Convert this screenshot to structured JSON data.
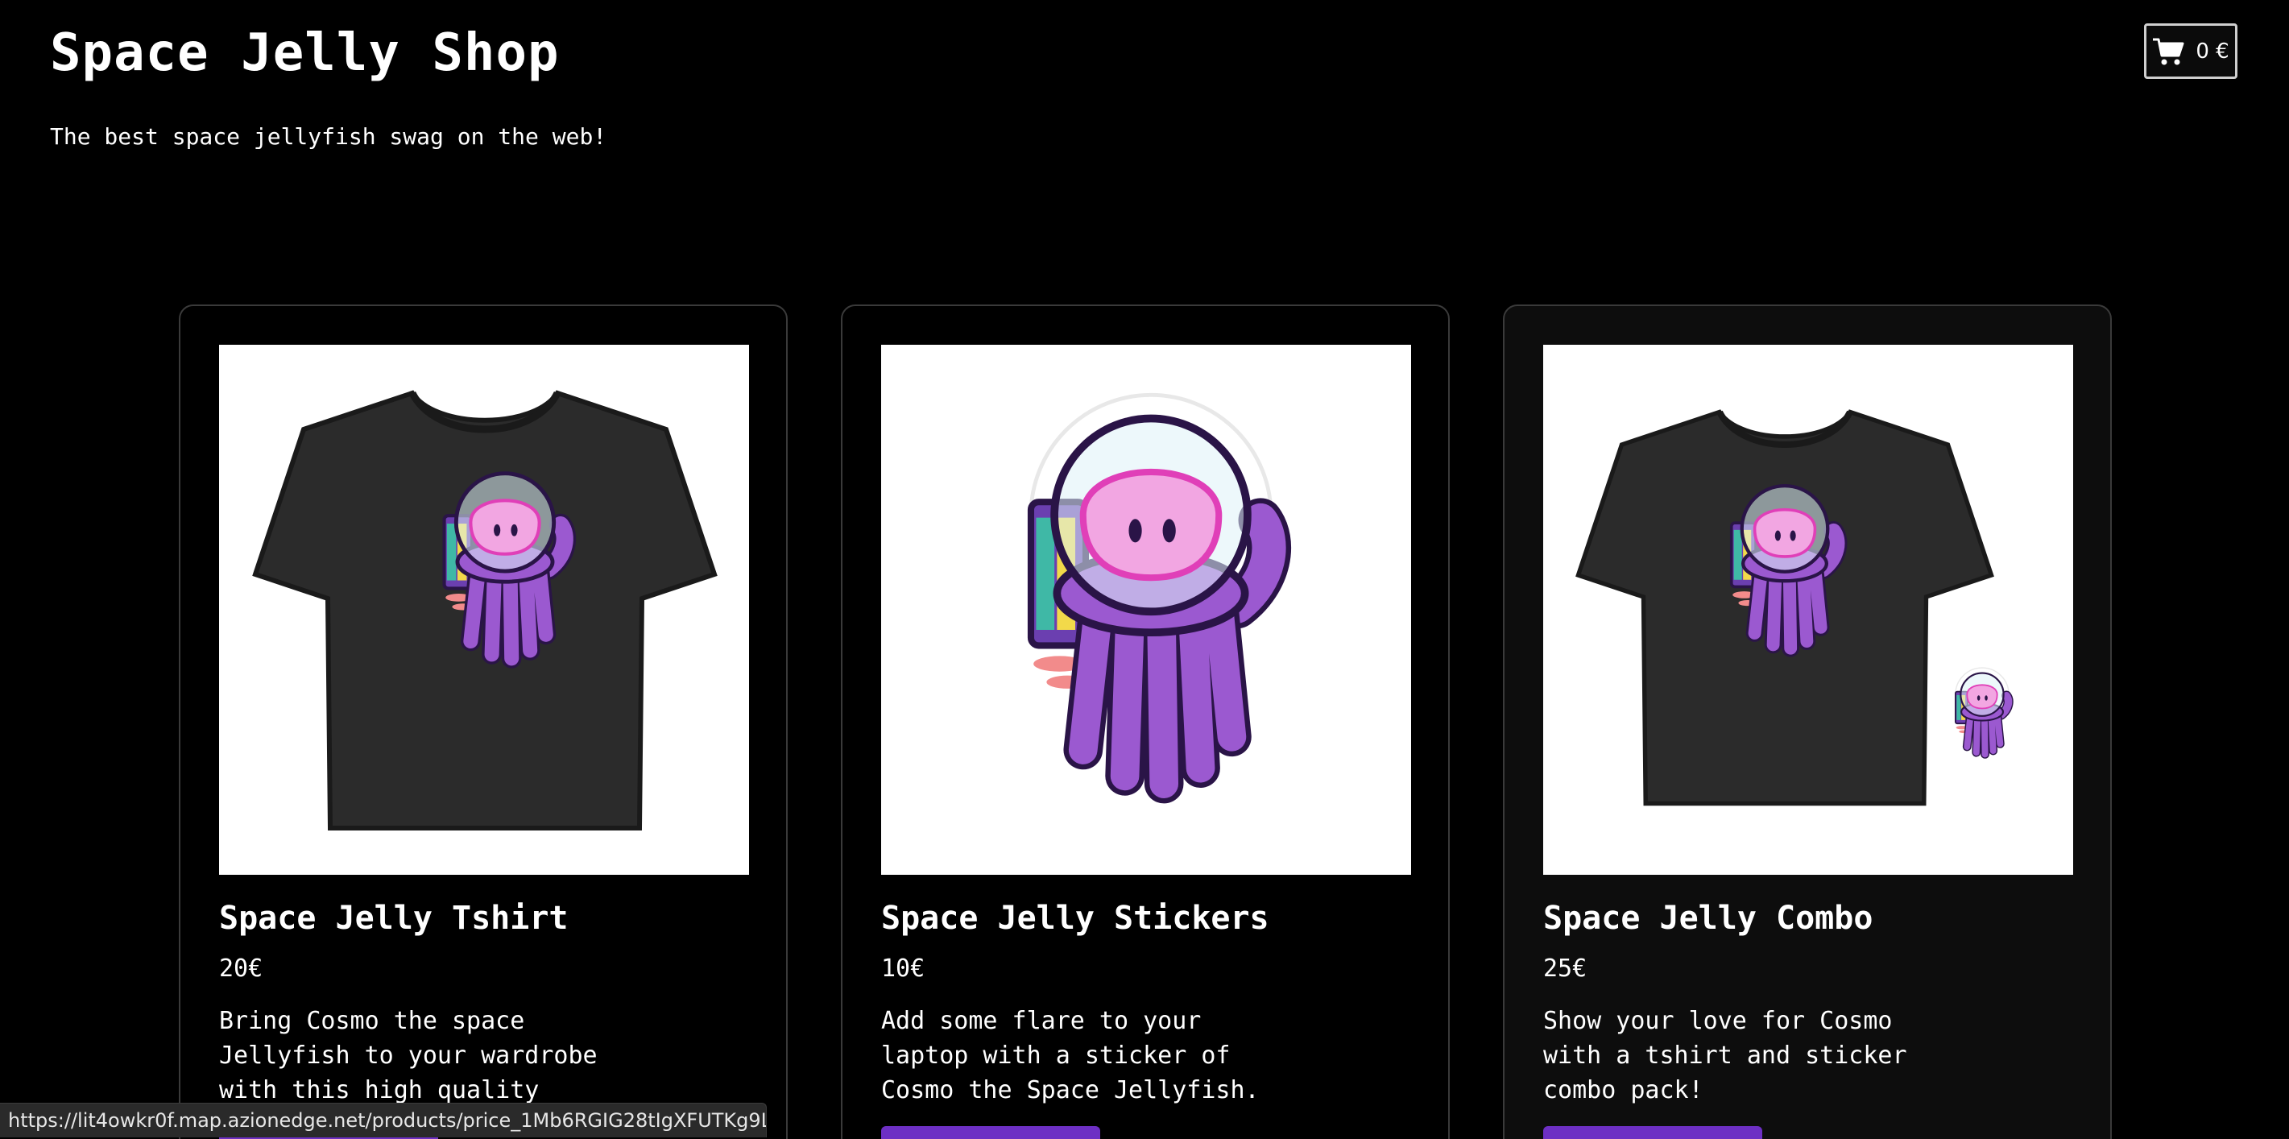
{
  "header": {
    "title": "Space Jelly Shop",
    "tagline": "The best space jellyfish swag on the web!"
  },
  "cart": {
    "icon": "shopping-cart-icon",
    "total": "0 €"
  },
  "products": [
    {
      "image_alt": "Space Jelly Tshirt",
      "title": "Space Jelly Tshirt",
      "price": "20€",
      "description": "Bring Cosmo the space Jellyfish to your wardrobe with this high quality tshirt."
    },
    {
      "image_alt": "Space Jelly Stickers",
      "title": "Space Jelly Stickers",
      "price": "10€",
      "description": "Add some flare to your laptop with a sticker of Cosmo the Space Jellyfish."
    },
    {
      "image_alt": "Space Jelly Combo",
      "title": "Space Jelly Combo",
      "price": "25€",
      "description": "Show your love for Cosmo with a tshirt and sticker combo pack!"
    }
  ],
  "status_bar": {
    "url": "https://lit4owkr0f.map.azionedge.net/products/price_1Mb6RGIG28tIgXFUTKg9L..."
  },
  "colors": {
    "background": "#000000",
    "text": "#ffffff",
    "card_border": "#3a3a3a",
    "button": "#6d2fc4",
    "jelly_purple": "#9b59d0",
    "jelly_pink": "#f2a6e2"
  }
}
